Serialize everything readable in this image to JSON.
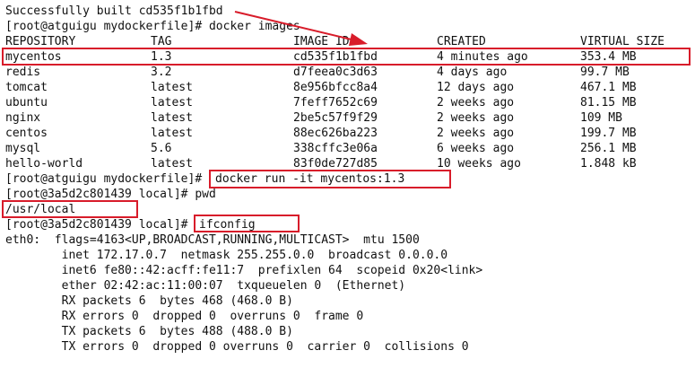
{
  "terminal": {
    "build_line": "Successfully built cd535f1b1fbd",
    "prompt_images": "[root@atguigu mydockerfile]# docker images",
    "columns": [
      "REPOSITORY",
      "TAG",
      "IMAGE ID",
      "CREATED",
      "VIRTUAL SIZE"
    ],
    "images": [
      {
        "repository": "mycentos",
        "tag": "1.3",
        "image_id": "cd535f1b1fbd",
        "created": "4 minutes ago",
        "size": "353.4 MB"
      },
      {
        "repository": "redis",
        "tag": "3.2",
        "image_id": "d7feea0c3d63",
        "created": "4 days ago",
        "size": "99.7 MB"
      },
      {
        "repository": "tomcat",
        "tag": "latest",
        "image_id": "8e956bfcc8a4",
        "created": "12 days ago",
        "size": "467.1 MB"
      },
      {
        "repository": "ubuntu",
        "tag": "latest",
        "image_id": "7feff7652c69",
        "created": "2 weeks ago",
        "size": "81.15 MB"
      },
      {
        "repository": "nginx",
        "tag": "latest",
        "image_id": "2be5c57f9f29",
        "created": "2 weeks ago",
        "size": "109 MB"
      },
      {
        "repository": "centos",
        "tag": "latest",
        "image_id": "88ec626ba223",
        "created": "2 weeks ago",
        "size": "199.7 MB"
      },
      {
        "repository": "mysql",
        "tag": "5.6",
        "image_id": "338cffc3e06a",
        "created": "6 weeks ago",
        "size": "256.1 MB"
      },
      {
        "repository": "hello-world",
        "tag": "latest",
        "image_id": "83f0de727d85",
        "created": "10 weeks ago",
        "size": "1.848 kB"
      }
    ],
    "prompt_run_prefix": "[root@atguigu mydockerfile]# ",
    "run_command": "docker run -it mycentos:1.3",
    "prompt_pwd": "[root@3a5d2c801439 local]# pwd",
    "pwd_output": "/usr/local",
    "prompt_ifconfig_prefix": "[root@3a5d2c801439 local]# ",
    "ifconfig_command": "ifconfig",
    "ifconfig_output": [
      "eth0:  flags=4163<UP,BROADCAST,RUNNING,MULTICAST>  mtu 1500",
      "        inet 172.17.0.7  netmask 255.255.0.0  broadcast 0.0.0.0",
      "        inet6 fe80::42:acff:fe11:7  prefixlen 64  scopeid 0x20<link>",
      "        ether 02:42:ac:11:00:07  txqueuelen 0  (Ethernet)",
      "        RX packets 6  bytes 468 (468.0 B)",
      "        RX errors 0  dropped 0  overruns 0  frame 0",
      "        TX packets 6  bytes 488 (488.0 B)",
      "        TX errors 0  dropped 0 overruns 0  carrier 0  collisions 0"
    ],
    "highlight_color": "#d81c2a"
  }
}
